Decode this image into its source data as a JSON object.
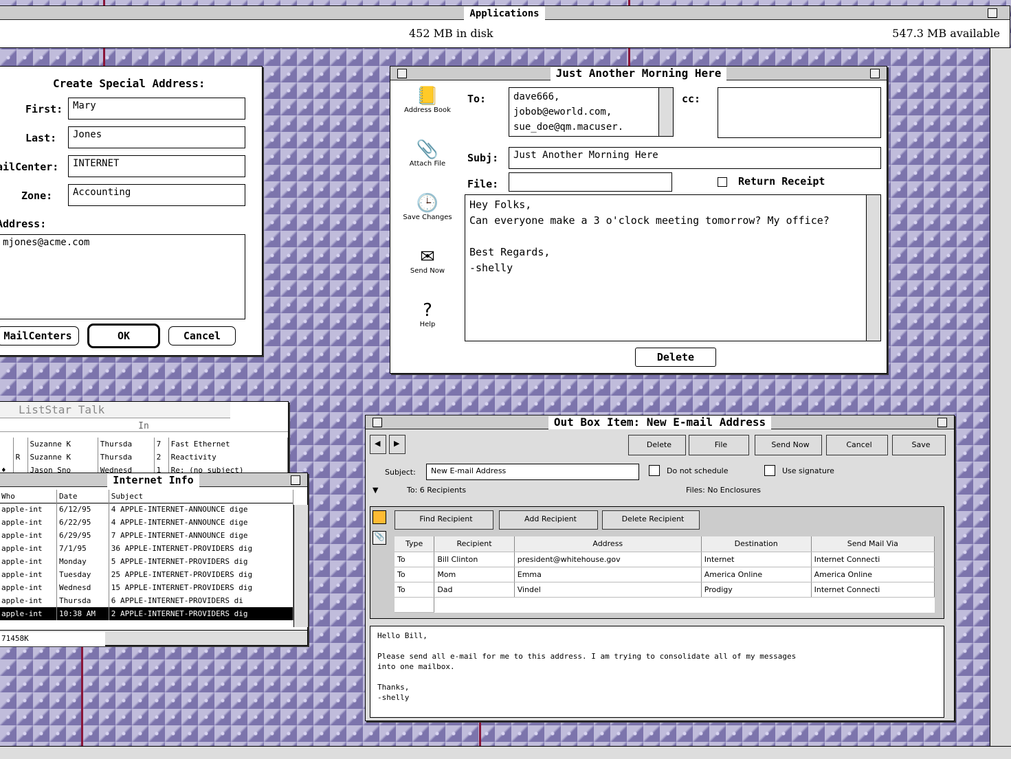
{
  "finder": {
    "title": "Applications",
    "disk": "452 MB in disk",
    "available": "547.3 MB available"
  },
  "special": {
    "title": "Create Special Address:",
    "first_label": "First:",
    "first": "Mary",
    "last_label": "Last:",
    "last": "Jones",
    "mc_label": "ailCenter:",
    "mc": "INTERNET",
    "zone_label": "Zone:",
    "zone": "Accounting",
    "addr_label": "Address:",
    "addr": "mjones@acme.com",
    "b1": "MailCenters",
    "b2": "OK",
    "b3": "Cancel"
  },
  "mail": {
    "title": "Just Another Morning Here",
    "to_label": "To:",
    "to": "dave666,\njobob@eworld.com,\nsue_doe@qm.macuser.",
    "cc_label": "cc:",
    "subj_label": "Subj:",
    "subj": "Just Another Morning Here",
    "file_label": "File:",
    "rr": "Return Receipt",
    "body": "Hey Folks,\nCan everyone make a 3 o'clock meeting tomorrow? My office?\n\nBest Regards,\n-shelly",
    "delete": "Delete",
    "icons": [
      {
        "label": "Address Book",
        "glyph": "📒"
      },
      {
        "label": "Attach File",
        "glyph": "📎"
      },
      {
        "label": "Save Changes",
        "glyph": "🕒"
      },
      {
        "label": "Send Now",
        "glyph": "✉"
      },
      {
        "label": "Help",
        "glyph": "?"
      }
    ]
  },
  "listar": {
    "title": "ListStar Talk",
    "in": "In",
    "rows": [
      [
        "",
        "",
        "Suzanne K",
        "Thursda",
        "7",
        "Fast Ethernet"
      ],
      [
        "",
        "R",
        "Suzanne K",
        "Thursda",
        "2",
        "Reactivity"
      ],
      [
        "♦",
        "",
        "Jason Sno",
        "Wednesd",
        "1",
        "Re: (no subject)"
      ]
    ]
  },
  "inet": {
    "title": "Internet Info",
    "cols": [
      "Who",
      "Date",
      "Subject"
    ],
    "rows": [
      [
        "apple-int",
        "6/12/95",
        "4 APPLE-INTERNET-ANNOUNCE dige"
      ],
      [
        "apple-int",
        "6/22/95",
        "4 APPLE-INTERNET-ANNOUNCE dige"
      ],
      [
        "apple-int",
        "6/29/95",
        "7 APPLE-INTERNET-ANNOUNCE dige"
      ],
      [
        "apple-int",
        "7/1/95",
        "36 APPLE-INTERNET-PROVIDERS dig"
      ],
      [
        "apple-int",
        "Monday",
        "5 APPLE-INTERNET-PROVIDERS dig"
      ],
      [
        "apple-int",
        "Tuesday",
        "25 APPLE-INTERNET-PROVIDERS dig"
      ],
      [
        "apple-int",
        "Wednesd",
        "15 APPLE-INTERNET-PROVIDERS dig"
      ],
      [
        "apple-int",
        "Thursda",
        "6 APPLE-INTERNET-PROVIDERS di"
      ],
      [
        "apple-int",
        "10:38 AM",
        "2 APPLE-INTERNET-PROVIDERS dig"
      ]
    ],
    "footer": "71458K"
  },
  "outbox": {
    "title": "Out Box Item: New E-mail Address",
    "tb": [
      "Delete",
      "File",
      "Send Now",
      "Cancel",
      "Save"
    ],
    "subj_label": "Subject:",
    "subj": "New E-mail Address",
    "ns": "Do not schedule",
    "sig": "Use signature",
    "to": "To: 6 Recipients",
    "files": "Files: No Enclosures",
    "rb": [
      "Find Recipient",
      "Add Recipient",
      "Delete Recipient"
    ],
    "cols": [
      "Type",
      "Recipient",
      "Address",
      "Destination",
      "Send Mail Via"
    ],
    "rows": [
      [
        "To",
        "Bill Clinton",
        "president@whitehouse.gov",
        "Internet",
        "Internet Connecti"
      ],
      [
        "To",
        "Mom",
        "Emma",
        "America Online",
        "America Online"
      ],
      [
        "To",
        "Dad",
        "Vindel",
        "Prodigy",
        "Internet Connecti"
      ]
    ],
    "body": "Hello Bill,\n\nPlease send all e-mail for me to this address. I am trying to consolidate all of my messages\ninto one mailbox.\n\nThanks,\n-shelly"
  }
}
